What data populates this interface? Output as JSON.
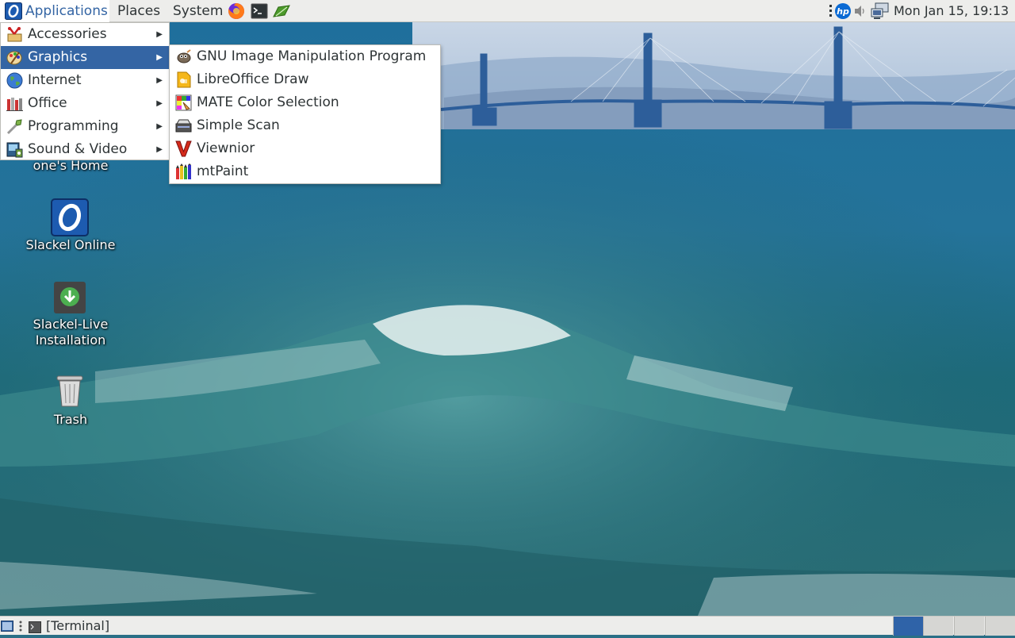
{
  "top_panel": {
    "applications_label": "Applications",
    "places_label": "Places",
    "system_label": "System",
    "launchers": [
      "firefox-icon",
      "terminal-icon",
      "leaf-icon"
    ],
    "tray": [
      "hp-icon",
      "volume-icon",
      "network-icon"
    ],
    "clock": "Mon Jan 15, 19:13"
  },
  "applications_menu": {
    "items": [
      {
        "label": "Accessories",
        "icon": "accessories-icon"
      },
      {
        "label": "Graphics",
        "icon": "graphics-icon",
        "selected": true
      },
      {
        "label": "Internet",
        "icon": "internet-globe-icon"
      },
      {
        "label": "Office",
        "icon": "office-icon"
      },
      {
        "label": "Programming",
        "icon": "programming-icon"
      },
      {
        "label": "Sound & Video",
        "icon": "sound-video-icon"
      }
    ]
  },
  "graphics_submenu": {
    "items": [
      {
        "label": "GNU Image Manipulation Program",
        "icon": "gimp-icon"
      },
      {
        "label": "LibreOffice Draw",
        "icon": "libreoffice-draw-icon"
      },
      {
        "label": "MATE Color Selection",
        "icon": "color-selection-icon"
      },
      {
        "label": "Simple Scan",
        "icon": "scanner-icon"
      },
      {
        "label": "Viewnior",
        "icon": "viewnior-icon"
      },
      {
        "label": "mtPaint",
        "icon": "mtpaint-icon"
      }
    ]
  },
  "desktop_icons": {
    "home": "one's Home",
    "slackel_online": "Slackel Online",
    "live_install_line1": "Slackel-Live",
    "live_install_line2": "Installation",
    "trash": "Trash"
  },
  "bottom_panel": {
    "task_label": "[Terminal]",
    "workspaces": 4,
    "active_workspace": 1
  },
  "colors": {
    "selection": "#3465a4",
    "panel": "#ededeb",
    "menu_text": "#2e3436"
  }
}
